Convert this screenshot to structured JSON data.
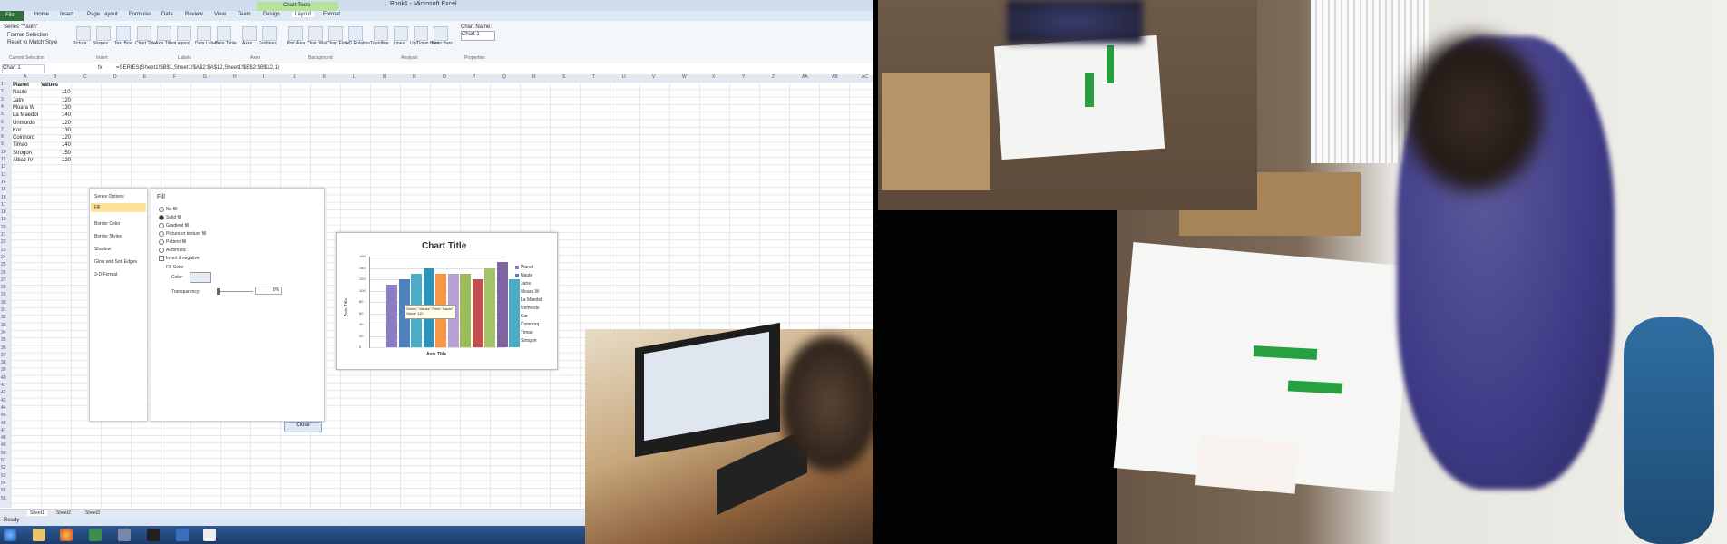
{
  "excel": {
    "title": "Book1 - Microsoft Excel",
    "file_tab": "File",
    "chart_tools": "Chart Tools",
    "tabs": [
      "Home",
      "Insert",
      "Page Layout",
      "Formulas",
      "Data",
      "Review",
      "View",
      "Team",
      "Design",
      "Layout",
      "Format"
    ],
    "ribbon_group_labels": [
      "Current Selection",
      "Insert",
      "Labels",
      "Axes",
      "Background",
      "Analysis",
      "Properties"
    ],
    "ribbon_buttons": [
      "Picture",
      "Shapes",
      "Text Box",
      "Chart Title",
      "Axis Titles",
      "Legend",
      "Data Labels",
      "Data Table",
      "Axes",
      "Gridlines",
      "Plot Area",
      "Chart Wall",
      "Chart Floor",
      "3-D Rotation",
      "Trendline",
      "Lines",
      "Up/Down Bars",
      "Error Bars"
    ],
    "current_selection_items": [
      "Series \"Yaoin\"",
      "Format Selection",
      "Reset to Match Style"
    ],
    "chart_name_label": "Chart Name:",
    "chart_name_value": "Chart 1",
    "name_box": "Chart 1",
    "formula": "=SERIES(Sheet1!$B$1,Sheet1!$A$2:$A$12,Sheet1!$B$2:$B$12,1)",
    "columns": [
      "A",
      "B",
      "C",
      "D",
      "E",
      "F",
      "G",
      "H",
      "I",
      "J",
      "K",
      "L",
      "M",
      "N",
      "O",
      "P",
      "Q",
      "R",
      "S",
      "T",
      "U",
      "V",
      "W",
      "X",
      "Y",
      "Z",
      "AA",
      "AB",
      "AC",
      "AD"
    ],
    "table": {
      "headers": [
        "Planet",
        "Values"
      ],
      "rows": [
        [
          "Naute",
          "110"
        ],
        [
          "Jatre",
          "120"
        ],
        [
          "Moara W",
          "130"
        ],
        [
          "La Maedol",
          "140"
        ],
        [
          "Unmordo",
          "120"
        ],
        [
          "Kor",
          "130"
        ],
        [
          "Coinnorq",
          "120"
        ],
        [
          "Timao",
          "140"
        ],
        [
          "Strogon",
          "150"
        ],
        [
          "Albaz IV",
          "120"
        ]
      ]
    },
    "format_nav": [
      "Series Options",
      "Fill",
      "Border Color",
      "Border Styles",
      "Shadow",
      "Glow and Soft Edges",
      "3-D Format"
    ],
    "format_panel": {
      "heading": "Fill",
      "options": [
        "No fill",
        "Solid fill",
        "Gradient fill",
        "Picture or texture fill",
        "Pattern fill",
        "Automatic",
        "Invert if negative",
        "Fill Color"
      ],
      "selected_option": "Solid fill",
      "color_label": "Color:",
      "transparency_label": "Transparency:",
      "transparency_value": "0%",
      "close_button": "Close"
    },
    "sheet_tabs": [
      "Sheet1",
      "Sheet2",
      "Sheet3"
    ],
    "status": "Ready"
  },
  "chart_data": {
    "type": "bar",
    "title": "Chart Title",
    "xlabel": "Axis Title",
    "ylabel": "Axis Title",
    "ylim": [
      0,
      160
    ],
    "yticks": [
      "0",
      "20",
      "40",
      "60",
      "80",
      "100",
      "120",
      "140",
      "160"
    ],
    "series": [
      {
        "name": "Planet",
        "value": 110,
        "color": "#8e7cc3"
      },
      {
        "name": "Naute",
        "value": 120,
        "color": "#4f81bd"
      },
      {
        "name": "Jatre",
        "value": 130,
        "color": "#4bacc6"
      },
      {
        "name": "Moara W",
        "value": 140,
        "color": "#2e93b8"
      },
      {
        "name": "La Maedol",
        "value": 130,
        "color": "#f79646"
      },
      {
        "name": "Unmordo",
        "value": 130,
        "color": "#b7a1d6"
      },
      {
        "name": "Kor",
        "value": 130,
        "color": "#9bbb59"
      },
      {
        "name": "Coinnorq",
        "value": 120,
        "color": "#c0504d"
      },
      {
        "name": "Timao",
        "value": 140,
        "color": "#a5c46a"
      },
      {
        "name": "Strogon",
        "value": 150,
        "color": "#8064a2"
      },
      {
        "name": "Albaz IV",
        "value": 120,
        "color": "#4bacc6"
      }
    ],
    "legend_position": "right",
    "tooltip": "Series \"Values\" Point \"Naute\" Value: 110"
  }
}
